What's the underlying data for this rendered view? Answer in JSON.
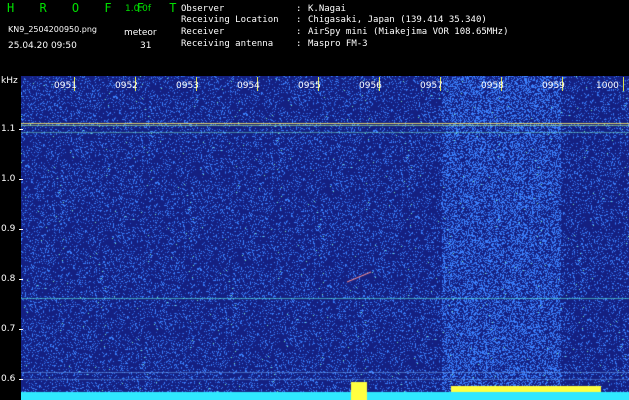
{
  "header": {
    "brand": "H R O F F T",
    "version": "1.0.0f",
    "filename": "KN9_2504200950.png",
    "datetime": "25.04.20 09:50",
    "meteor_label": "meteor",
    "meteor_count": "31"
  },
  "observer_info": {
    "rows": [
      {
        "label": "Observer",
        "value": "K.Nagai"
      },
      {
        "label": "Receiving Location",
        "value": "Chigasaki, Japan (139.414 35.340)"
      },
      {
        "label": "Receiver",
        "value": "AirSpy mini (Miakejima VOR 108.65MHz)"
      },
      {
        "label": "Receiving antenna",
        "value": "Maspro FM-3"
      }
    ]
  },
  "spectrogram": {
    "y_axis_unit": "kHz",
    "y_ticks": [
      "1.1",
      "1.0",
      "0.9",
      "0.8",
      "0.7",
      "0.6"
    ],
    "x_ticks": [
      "0951",
      "0952",
      "0953",
      "0954",
      "0955",
      "0956",
      "0957",
      "0958",
      "0959",
      "1000"
    ],
    "colors": {
      "background": "#1c2a8a",
      "noise": "#4a8cff",
      "line": "#ffee66",
      "baseline": "#30e8ff"
    }
  }
}
